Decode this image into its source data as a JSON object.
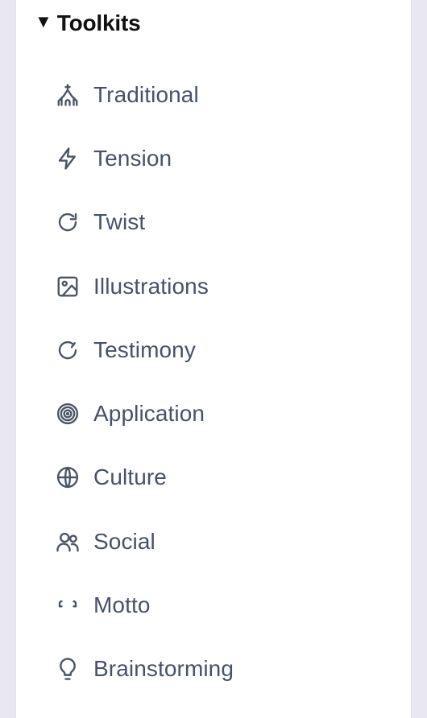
{
  "section": {
    "caret": "▼",
    "title": "Toolkits"
  },
  "items": [
    {
      "label": "Traditional",
      "icon": "church-icon"
    },
    {
      "label": "Tension",
      "icon": "lightning-icon"
    },
    {
      "label": "Twist",
      "icon": "refresh-icon"
    },
    {
      "label": "Illustrations",
      "icon": "image-icon"
    },
    {
      "label": "Testimony",
      "icon": "circle-arrow-icon"
    },
    {
      "label": "Application",
      "icon": "target-icon"
    },
    {
      "label": "Culture",
      "icon": "globe-icon"
    },
    {
      "label": "Social",
      "icon": "users-icon"
    },
    {
      "label": "Motto",
      "icon": "quote-brackets-icon"
    },
    {
      "label": "Brainstorming",
      "icon": "lightbulb-icon"
    }
  ],
  "colors": {
    "background": "#e9e8f1",
    "panel": "#ffffff",
    "title": "#111111",
    "item_text": "#47526a",
    "icon": "#4a5566"
  }
}
